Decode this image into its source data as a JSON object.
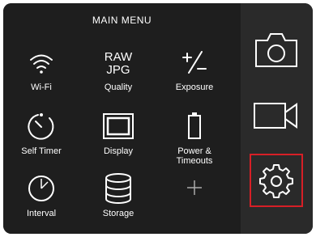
{
  "menu": {
    "title": "MAIN MENU",
    "items": [
      {
        "label": "Wi-Fi",
        "icon": "wifi-icon"
      },
      {
        "label": "Quality",
        "icon": "raw-jpg-icon",
        "icon_text_top": "RAW",
        "icon_text_bottom": "JPG"
      },
      {
        "label": "Exposure",
        "icon": "plus-minus-icon"
      },
      {
        "label": "Self Timer",
        "icon": "timer-icon"
      },
      {
        "label": "Display",
        "icon": "display-icon"
      },
      {
        "label": "Power &\nTimeouts",
        "icon": "battery-icon"
      },
      {
        "label": "Interval",
        "icon": "clock-icon"
      },
      {
        "label": "Storage",
        "icon": "database-icon"
      },
      {
        "label": "",
        "icon": "add-icon"
      }
    ]
  },
  "sidebar": {
    "items": [
      {
        "icon": "camera-icon"
      },
      {
        "icon": "video-camera-icon"
      },
      {
        "icon": "gear-icon",
        "selected": true
      }
    ]
  },
  "colors": {
    "background": "#1e1e1e",
    "sidebar": "#2a2a2a",
    "foreground": "#ffffff",
    "selection": "#d71f26"
  }
}
